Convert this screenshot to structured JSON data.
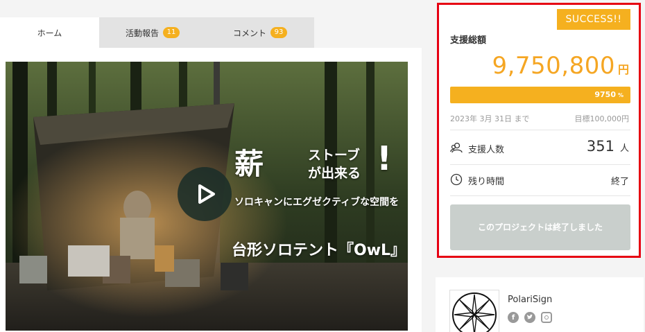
{
  "tabs": [
    {
      "label": "ホーム",
      "active": true
    },
    {
      "label": "活動報告",
      "badge": "11"
    },
    {
      "label": "コメント",
      "badge": "93"
    }
  ],
  "video": {
    "headline_kanji": "薪",
    "headline_stove_1": "ストーブ",
    "headline_stove_2": "が出来る",
    "headline_exclaim": "!",
    "subline": "ソロキャンにエグゼクティブな空間を",
    "title": "台形ソロテント『OwL』",
    "play_icon": "play-icon"
  },
  "funding": {
    "status_badge": "SUCCESS!!",
    "total_label": "支援総額",
    "amount": "9,750,800",
    "amount_unit": "円",
    "progress_value": "9750",
    "progress_unit": "%",
    "progress_fraction": 1.0,
    "deadline": "2023年 3月 31日 まで",
    "target": "目標100,000円",
    "supporters_label": "支援人数",
    "supporters_count": "351",
    "supporters_unit": "人",
    "time_label": "残り時間",
    "time_value": "終了",
    "ended_button": "このプロジェクトは終了しました",
    "accent_color": "#f5b01f",
    "highlight_color": "#e60012"
  },
  "owner": {
    "name": "PolariSign",
    "social": [
      "facebook-icon",
      "twitter-icon",
      "instagram-icon"
    ]
  }
}
